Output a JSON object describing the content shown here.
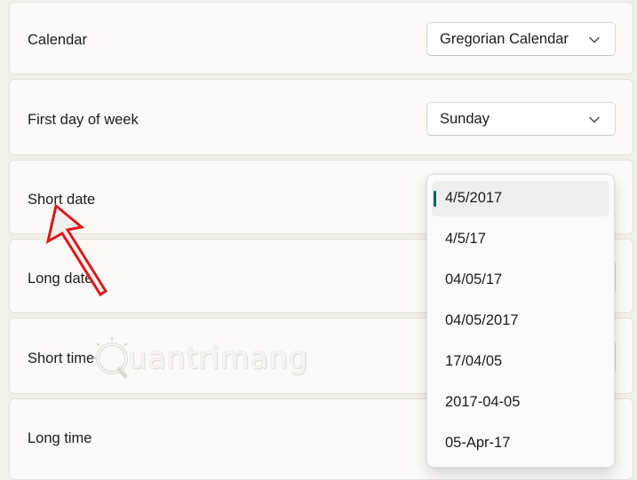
{
  "rows": [
    {
      "label": "Calendar",
      "value": "Gregorian Calendar"
    },
    {
      "label": "First day of week",
      "value": "Sunday"
    },
    {
      "label": "Short date"
    },
    {
      "label": "Long date"
    },
    {
      "label": "Short time"
    },
    {
      "label": "Long time"
    }
  ],
  "short_date_options": [
    "4/5/2017",
    "4/5/17",
    "04/05/17",
    "04/05/2017",
    "17/04/05",
    "2017-04-05",
    "05-Apr-17"
  ],
  "selected_option": "4/5/2017",
  "watermark": {
    "text": "uantrimang"
  },
  "colors": {
    "accent": "#005f6b",
    "annotation_arrow": "#d91a1a",
    "background": "#f3f0ea",
    "card": "#fbfaf6"
  }
}
